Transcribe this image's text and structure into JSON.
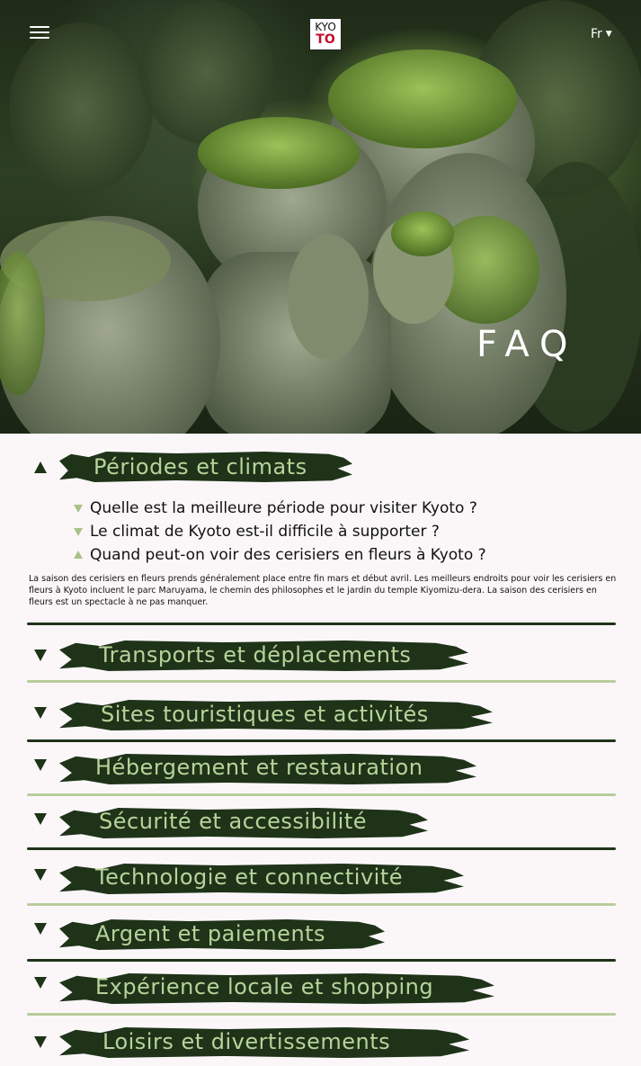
{
  "header": {
    "logo_top": "KYO",
    "logo_bottom": "TO",
    "language": "Fr",
    "hero_title": "FAQ"
  },
  "faq": {
    "open_category": {
      "title": "Périodes et climats",
      "questions": [
        {
          "text": "Quelle est la meilleure période pour visiter Kyoto ?",
          "expanded": false
        },
        {
          "text": "Le climat de Kyoto est-il difficile à supporter ?",
          "expanded": false
        },
        {
          "text": "Quand peut-on voir des cerisiers en fleurs à Kyoto ?",
          "expanded": true
        }
      ],
      "answer": "La saison des cerisiers en fleurs prends généralement place entre fin mars et début avril. Les meilleurs endroits pour voir les cerisiers en fleurs à Kyoto incluent le parc Maruyama, le chemin des philosophes et le jardin du temple Kiyomizu-dera. La saison des cerisiers en fleurs est un spectacle à ne pas manquer."
    },
    "categories": [
      "Transports et déplacements",
      "Sites touristiques et activités",
      "Hébergement et restauration",
      "Sécurité et accessibilité",
      "Technologie et connectivité",
      "Argent et paiements",
      "Expérience locale et shopping",
      "Loisirs et divertissements"
    ]
  },
  "colors": {
    "brush": "#1f3319",
    "label": "#b8d39a",
    "separator_light": "#b8cc9c",
    "background": "#fbf7f9"
  },
  "icons": [
    "menu-icon",
    "chevron-down-icon",
    "chevron-up-icon"
  ]
}
